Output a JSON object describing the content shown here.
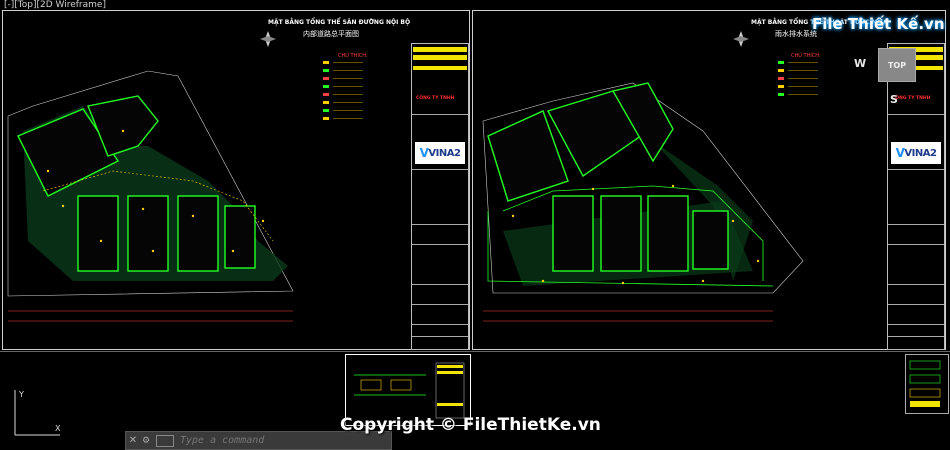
{
  "viewport": {
    "label": "[-][Top][2D Wireframe]"
  },
  "left_sheet": {
    "title": "MẶT BẰNG TỔNG THỂ SÂN ĐƯỜNG NỘI BỘ",
    "subtitle": "内部道路总平面图",
    "legend_title": "CHÚ THÍCH:",
    "company": "CÔNG TY TNHH",
    "logo": "VINA2"
  },
  "right_sheet": {
    "title": "MẶT BẰNG TỔNG THỂ THOÁT NƯỚC MƯA",
    "subtitle": "雨水排水系统",
    "legend_title": "CHÚ THÍCH:",
    "company": "CÔNG TY TNHH",
    "logo": "VINA2"
  },
  "navigation": {
    "compass_w": "W",
    "compass_s": "S",
    "viewcube_label": "TOP"
  },
  "command_line": {
    "placeholder": "Type a command"
  },
  "watermark": {
    "text": "Copyright © FileThietKe.vn"
  },
  "brand_logo": {
    "text": "File Thiết Kế.vn"
  },
  "colors": {
    "background": "#000000",
    "building_outline": "#22ff22",
    "title_block_yellow": "#f0e400",
    "red_text": "#ff3030",
    "logo_blue": "#1e3a8a"
  }
}
